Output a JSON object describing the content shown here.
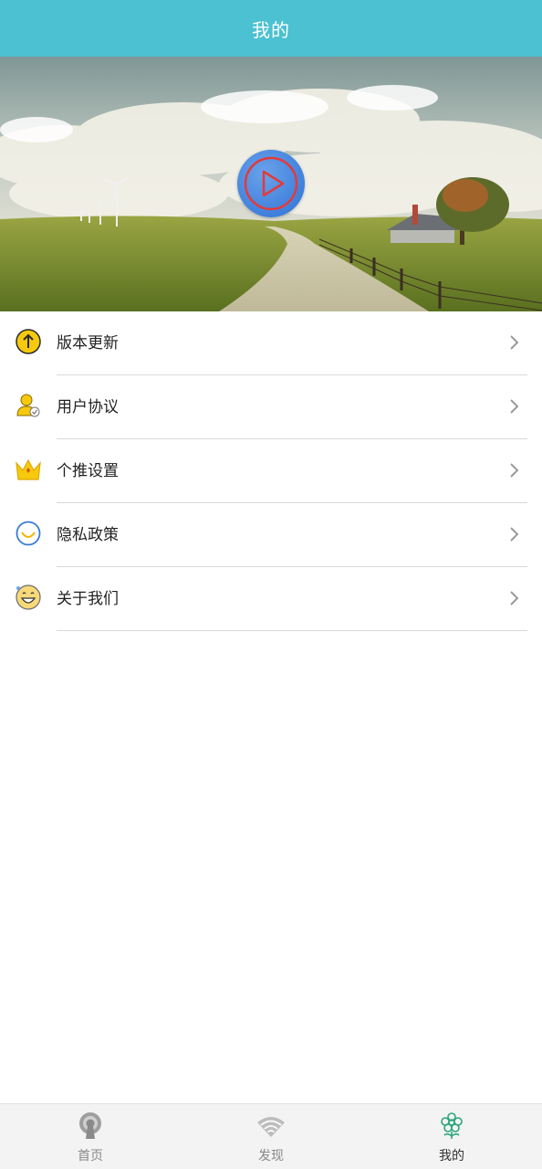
{
  "header": {
    "title": "我的"
  },
  "menu": {
    "items": [
      {
        "label": "版本更新",
        "icon": "upload-arrow-icon"
      },
      {
        "label": "用户协议",
        "icon": "user-check-icon"
      },
      {
        "label": "个推设置",
        "icon": "crown-icon"
      },
      {
        "label": "隐私政策",
        "icon": "smile-circle-icon"
      },
      {
        "label": "关于我们",
        "icon": "laughing-face-icon"
      }
    ]
  },
  "bottom_nav": {
    "items": [
      {
        "label": "首页",
        "icon": "home-icon",
        "active": false
      },
      {
        "label": "发现",
        "icon": "wifi-icon",
        "active": false
      },
      {
        "label": "我的",
        "icon": "flower-icon",
        "active": true
      }
    ]
  },
  "colors": {
    "header": "#4bc1d2",
    "play_button": "#3f80dc",
    "play_ring": "#e33a3a",
    "active_nav_icon": "#2aa67a"
  }
}
